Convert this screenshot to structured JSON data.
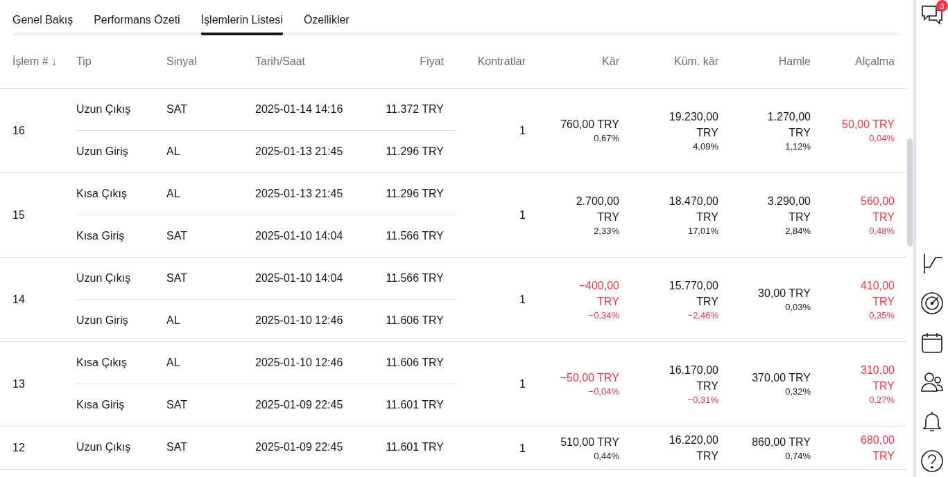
{
  "tabs": [
    {
      "label": "Genel Bakış",
      "selected": false
    },
    {
      "label": "Performans Özeti",
      "selected": false
    },
    {
      "label": "İşlemlerin Listesi",
      "selected": true
    },
    {
      "label": "Özellikler",
      "selected": false
    }
  ],
  "columns": [
    "İşlem #",
    "Tip",
    "Sinyal",
    "Tarih/Saat",
    "Fiyat",
    "Kontratlar",
    "Kâr",
    "Küm. kâr",
    "Hamle",
    "Alçalma"
  ],
  "sort_indicator": "↓",
  "rows": [
    {
      "number": "16",
      "trades": [
        {
          "type": "Uzun Çıkış",
          "signal": "SAT",
          "datetime": "2025-01-14 14:16",
          "price": "11.372 TRY"
        },
        {
          "type": "Uzun Giriş",
          "signal": "AL",
          "datetime": "2025-01-13 21:45",
          "price": "11.296 TRY"
        }
      ],
      "contracts": "1",
      "profit": {
        "value": "760,00 TRY",
        "percent": "0,67%",
        "value_negative": false,
        "percent_negative": false
      },
      "cum_profit": {
        "value": "19.230,00 TRY",
        "percent": "4,09%",
        "value_negative": false,
        "percent_negative": false
      },
      "run_up": {
        "value": "1.270,00 TRY",
        "percent": "1,12%",
        "value_negative": false,
        "percent_negative": false
      },
      "drawdown": {
        "value": "50,00 TRY",
        "percent": "0,04%",
        "value_negative": true,
        "percent_negative": true
      }
    },
    {
      "number": "15",
      "trades": [
        {
          "type": "Kısa Çıkış",
          "signal": "AL",
          "datetime": "2025-01-13 21:45",
          "price": "11.296 TRY"
        },
        {
          "type": "Kısa Giriş",
          "signal": "SAT",
          "datetime": "2025-01-10 14:04",
          "price": "11.566 TRY"
        }
      ],
      "contracts": "1",
      "profit": {
        "value": "2.700,00 TRY",
        "percent": "2,33%",
        "value_negative": false,
        "percent_negative": false
      },
      "cum_profit": {
        "value": "18.470,00 TRY",
        "percent": "17,01%",
        "value_negative": false,
        "percent_negative": false
      },
      "run_up": {
        "value": "3.290,00 TRY",
        "percent": "2,84%",
        "value_negative": false,
        "percent_negative": false
      },
      "drawdown": {
        "value": "560,00 TRY",
        "percent": "0,48%",
        "value_negative": true,
        "percent_negative": true
      }
    },
    {
      "number": "14",
      "trades": [
        {
          "type": "Uzun Çıkış",
          "signal": "SAT",
          "datetime": "2025-01-10 14:04",
          "price": "11.566 TRY"
        },
        {
          "type": "Uzun Giriş",
          "signal": "AL",
          "datetime": "2025-01-10 12:46",
          "price": "11.606 TRY"
        }
      ],
      "contracts": "1",
      "profit": {
        "value": "−400,00 TRY",
        "percent": "−0,34%",
        "value_negative": true,
        "percent_negative": true
      },
      "cum_profit": {
        "value": "15.770,00 TRY",
        "percent": "−2,46%",
        "value_negative": false,
        "percent_negative": true
      },
      "run_up": {
        "value": "30,00 TRY",
        "percent": "0,03%",
        "value_negative": false,
        "percent_negative": false
      },
      "drawdown": {
        "value": "410,00 TRY",
        "percent": "0,35%",
        "value_negative": true,
        "percent_negative": true
      }
    },
    {
      "number": "13",
      "trades": [
        {
          "type": "Kısa Çıkış",
          "signal": "AL",
          "datetime": "2025-01-10 12:46",
          "price": "11.606 TRY"
        },
        {
          "type": "Kısa Giriş",
          "signal": "SAT",
          "datetime": "2025-01-09 22:45",
          "price": "11.601 TRY"
        }
      ],
      "contracts": "1",
      "profit": {
        "value": "−50,00 TRY",
        "percent": "−0,04%",
        "value_negative": true,
        "percent_negative": true
      },
      "cum_profit": {
        "value": "16.170,00 TRY",
        "percent": "−0,31%",
        "value_negative": false,
        "percent_negative": true
      },
      "run_up": {
        "value": "370,00 TRY",
        "percent": "0,32%",
        "value_negative": false,
        "percent_negative": false
      },
      "drawdown": {
        "value": "310,00 TRY",
        "percent": "0,27%",
        "value_negative": true,
        "percent_negative": true
      }
    },
    {
      "number": "12",
      "trades": [
        {
          "type": "Uzun Çıkış",
          "signal": "SAT",
          "datetime": "2025-01-09 22:45",
          "price": "11.601 TRY"
        }
      ],
      "contracts": "1",
      "profit": {
        "value": "510,00 TRY",
        "percent": "0,44%",
        "value_negative": false,
        "percent_negative": false
      },
      "cum_profit": {
        "value": "16.220,00 TRY",
        "value_negative": false
      },
      "run_up": {
        "value": "860,00 TRY",
        "percent": "0,74%",
        "value_negative": false,
        "percent_negative": false
      },
      "drawdown": {
        "value": "680,00 TRY",
        "value_negative": true
      }
    }
  ],
  "sidebar": {
    "chat_badge": "3"
  }
}
